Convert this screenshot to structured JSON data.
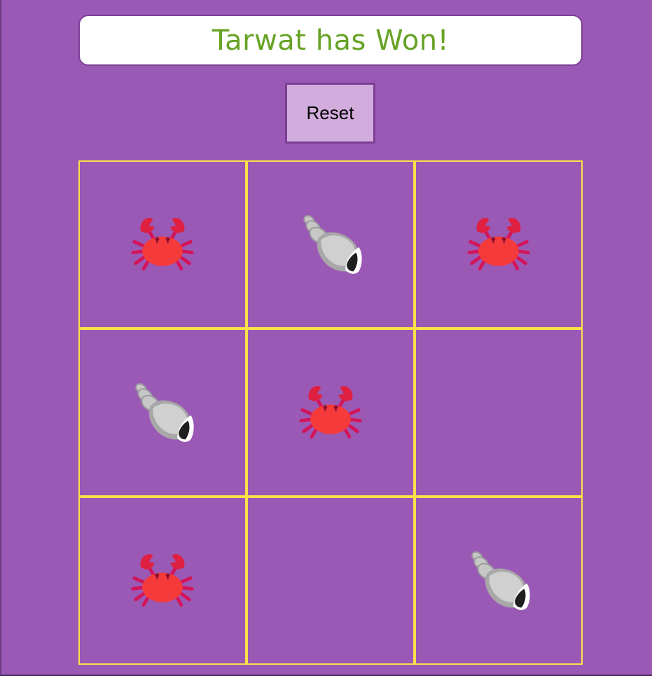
{
  "status": {
    "message": "Tarwat has Won!",
    "color": "#67a225"
  },
  "controls": {
    "reset_label": "Reset"
  },
  "board": {
    "cells": [
      "crab",
      "shell",
      "crab",
      "shell",
      "crab",
      "",
      "crab",
      "",
      "shell"
    ]
  },
  "colors": {
    "background": "#9b59b6",
    "grid_lines": "#fde047",
    "button_bg": "#d2acdc"
  }
}
